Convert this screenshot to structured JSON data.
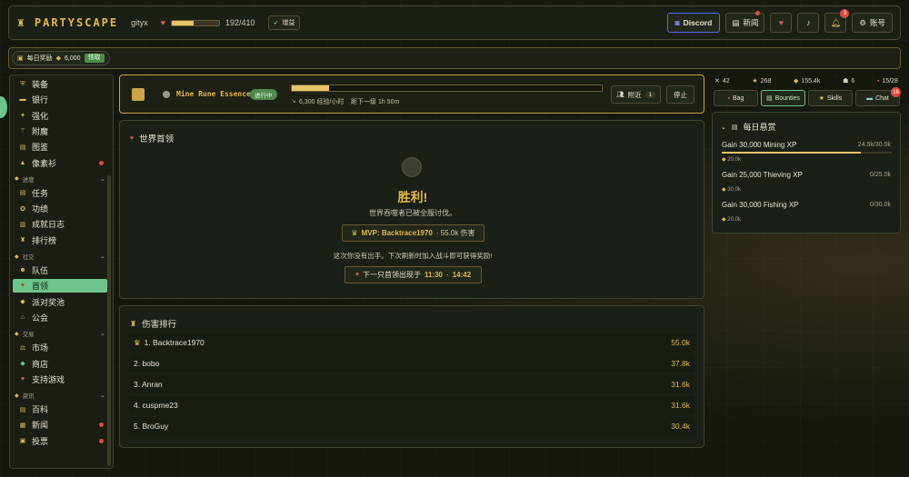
{
  "topbar": {
    "logo": "PARTYSCAPE",
    "username": "gityx",
    "hp_text": "192/410",
    "hp_fraction": 0.47,
    "boost_label": "增益",
    "discord_label": "Discord",
    "news_label": "新闻",
    "notifications_count": "3",
    "account_label": "账号"
  },
  "reward_strip": {
    "label": "每日奖励",
    "amount": "6,000",
    "claim_label": "领取"
  },
  "sidebar": {
    "items_top": [
      {
        "label": "装备",
        "icon": "shield-icon"
      },
      {
        "label": "银行",
        "icon": "chest-icon"
      },
      {
        "label": "强化",
        "icon": "sparkle-icon"
      },
      {
        "label": "附魔",
        "icon": "wand-icon"
      },
      {
        "label": "图鉴",
        "icon": "book-icon"
      },
      {
        "label": "像素衫",
        "icon": "shirt-icon",
        "dot": true
      }
    ],
    "groups": [
      {
        "label": "进度",
        "items": [
          {
            "label": "任务",
            "icon": "scroll-icon"
          },
          {
            "label": "功绩",
            "icon": "medal-icon"
          },
          {
            "label": "成就日志",
            "icon": "log-icon"
          },
          {
            "label": "排行榜",
            "icon": "trophy-icon"
          }
        ]
      },
      {
        "label": "社交",
        "items": [
          {
            "label": "队伍",
            "icon": "people-icon"
          },
          {
            "label": "首领",
            "icon": "boss-icon",
            "active": true
          },
          {
            "label": "派对奖池",
            "icon": "coins-icon"
          },
          {
            "label": "公会",
            "icon": "guild-icon"
          }
        ]
      },
      {
        "label": "交易",
        "items": [
          {
            "label": "市场",
            "icon": "market-icon"
          },
          {
            "label": "商店",
            "icon": "gem-icon"
          },
          {
            "label": "支持游戏",
            "icon": "heart-icon"
          }
        ]
      },
      {
        "label": "资讯",
        "items": [
          {
            "label": "百科",
            "icon": "wiki-icon"
          },
          {
            "label": "新闻",
            "icon": "news-icon",
            "dot": true
          },
          {
            "label": "投票",
            "icon": "vote-icon",
            "dot": true
          }
        ]
      }
    ]
  },
  "action": {
    "title": "Mine Rune Essence",
    "status": "进行中",
    "progress_fraction": 0.12,
    "xp_rate": "6,300 经验/小时",
    "next_level": "距下一级 1h 50m",
    "nearby_label": "附近",
    "nearby_count": "1",
    "stop_label": "停止"
  },
  "world_boss": {
    "title": "世界首领",
    "victory": "胜利!",
    "subtitle": "世界吞噬者已被全服讨伐。",
    "mvp_label": "MVP: Backtrace1970",
    "mvp_damage": "· 55.0k 伤害",
    "note": "这次你没有出手。下次刷新时加入战斗即可获得奖励!",
    "next_label": "下一只首领出现于",
    "next_time_a": "11:30",
    "next_sep": "·",
    "next_time_b": "14:42"
  },
  "damage_ranking": {
    "title": "伤害排行",
    "rows": [
      {
        "name": "1. Backtrace1970",
        "value": "55.0k",
        "crown": true
      },
      {
        "name": "2. bobo",
        "value": "37.8k"
      },
      {
        "name": "3. Anran",
        "value": "31.6k"
      },
      {
        "name": "4. cuspme23",
        "value": "31.6k"
      },
      {
        "name": "5. BroGuy",
        "value": "30.4k"
      }
    ]
  },
  "stats": [
    {
      "icon": "swords-icon",
      "value": "42"
    },
    {
      "icon": "star-icon",
      "value": "268"
    },
    {
      "icon": "coin-icon",
      "value": "155.4k"
    },
    {
      "icon": "skull-icon",
      "value": "6"
    },
    {
      "icon": "bag-icon",
      "value": "15/28"
    }
  ],
  "tabs": {
    "bag": "Bag",
    "bounties": "Bounties",
    "skills": "Skills",
    "chat": "Chat",
    "chat_badge": "16"
  },
  "bounties": {
    "title": "每日悬赏",
    "items": [
      {
        "title": "Gain 30,000 Mining XP",
        "progress": "24.5k/30.0k",
        "fraction": 0.82,
        "reward": "20.0k"
      },
      {
        "title": "Gain 25,000 Thieving XP",
        "progress": "0/25.0k",
        "fraction": 0,
        "reward": "30.0k"
      },
      {
        "title": "Gain 30,000 Fishing XP",
        "progress": "0/30.0k",
        "fraction": 0,
        "reward": "20.0k"
      }
    ]
  },
  "colors": {
    "accent": "#e2b84e",
    "active_green": "#6cc48a",
    "danger": "#e04a3a"
  }
}
